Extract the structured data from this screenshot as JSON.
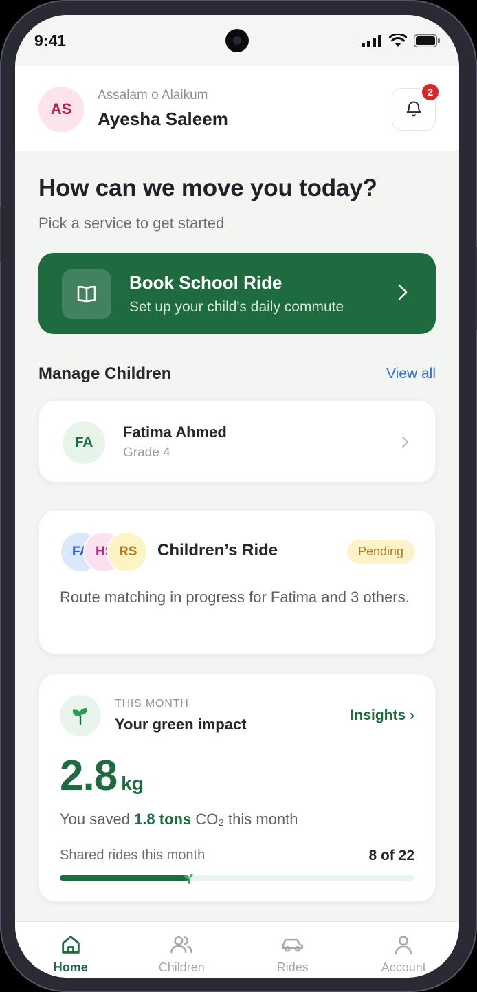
{
  "status_bar": {
    "time": "9:41"
  },
  "header": {
    "avatar_initials": "AS",
    "greeting": "Assalam o Alaikum",
    "user_name": "Ayesha Saleem",
    "notification_count": "2"
  },
  "hero": {
    "title": "How can we move you today?",
    "subtitle": "Pick a service to get started"
  },
  "book_card": {
    "title": "Book School Ride",
    "subtitle": "Set up your child's daily commute",
    "icon": "book-open-icon"
  },
  "manage_children": {
    "title": "Manage Children",
    "view_all": "View all",
    "children": [
      {
        "initials": "FA",
        "name": "Fatima Ahmed",
        "grade": "Grade 4"
      }
    ]
  },
  "ride_card": {
    "avatars": [
      {
        "initials": "FA",
        "bg": "#dbe7fb",
        "fg": "#2f5fbf"
      },
      {
        "initials": "HS",
        "bg": "#fbe0ef",
        "fg": "#b42a7a"
      },
      {
        "initials": "RS",
        "bg": "#fdf4c4",
        "fg": "#b7791f"
      }
    ],
    "title": "Children’s Ride",
    "status": "Pending",
    "description": "Route matching in progress for Fatima and 3 others."
  },
  "impact_card": {
    "overline": "THIS MONTH",
    "title": "Your green impact",
    "insights_link": "Insights ›",
    "value": "2.8",
    "unit": "kg",
    "saved_prefix": "You saved",
    "saved_amount": "1.8 tons",
    "saved_suffix": "CO₂ this month",
    "shared_label": "Shared rides this month",
    "shared_count": "8 of 22",
    "shared_done": 8,
    "shared_total": 22
  },
  "nav": {
    "items": [
      {
        "label": "Home",
        "icon": "home-icon",
        "active": true
      },
      {
        "label": "Children",
        "icon": "children-icon",
        "active": false
      },
      {
        "label": "Rides",
        "icon": "car-icon",
        "active": false
      },
      {
        "label": "Account",
        "icon": "account-icon",
        "active": false
      }
    ]
  },
  "colors": {
    "brand_green": "#1e6b40",
    "link_blue": "#2f6cd6",
    "badge_red": "#e02424",
    "pending_bg": "#fdf2c8",
    "pending_fg": "#b7791f"
  }
}
